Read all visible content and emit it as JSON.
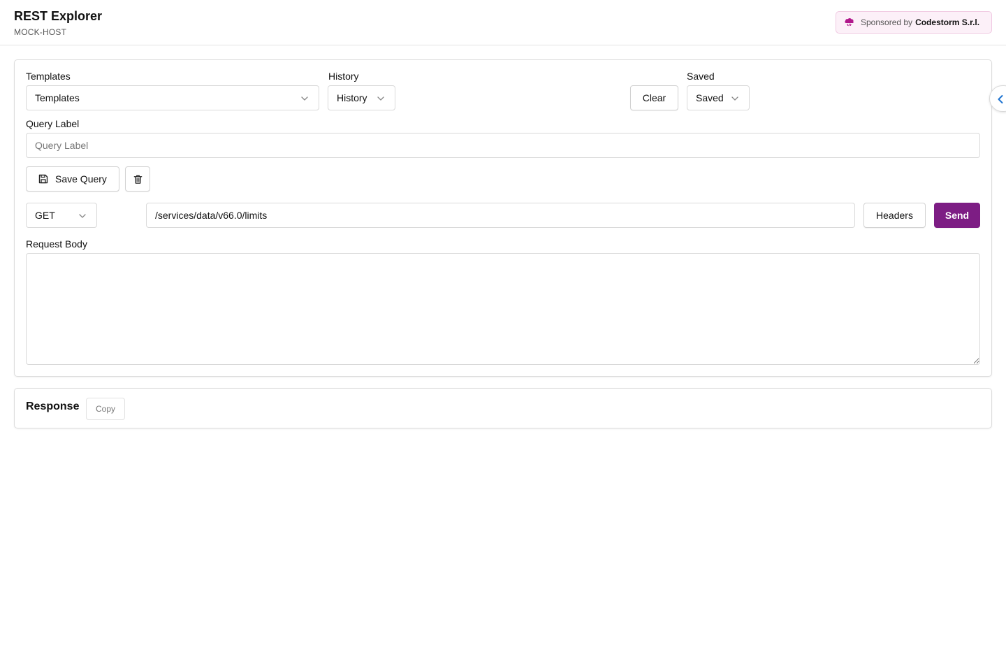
{
  "header": {
    "title": "REST Explorer",
    "subtitle": "MOCK-HOST",
    "sponsor": {
      "prefix": "Sponsored by",
      "name": "Codestorm S.r.l.",
      "icon": "cloud-code-icon"
    }
  },
  "request": {
    "templates": {
      "label": "Templates",
      "value": "Templates"
    },
    "history": {
      "label": "History",
      "value": "History"
    },
    "clear_label": "Clear",
    "saved": {
      "label": "Saved",
      "value": "Saved"
    },
    "query_label": {
      "label": "Query Label",
      "placeholder": "Query Label",
      "value": ""
    },
    "save_query_label": "Save Query",
    "method": {
      "value": "GET",
      "options": [
        "GET"
      ]
    },
    "url": {
      "value": "/services/data/v66.0/limits"
    },
    "headers_label": "Headers",
    "send_label": "Send",
    "body": {
      "label": "Request Body",
      "value": ""
    }
  },
  "response": {
    "title": "Response",
    "copy_label": "Copy"
  },
  "colors": {
    "accent": "#7d1d84",
    "sponsor_bg": "#fcf0f8",
    "sponsor_icon": "#b0178b",
    "toggle_icon": "#1f74d1"
  },
  "icons": {
    "dropdown": "chevron-down-icon",
    "save": "floppy-disk-icon",
    "delete": "trash-icon",
    "sidebar_toggle": "chevron-left-icon"
  }
}
